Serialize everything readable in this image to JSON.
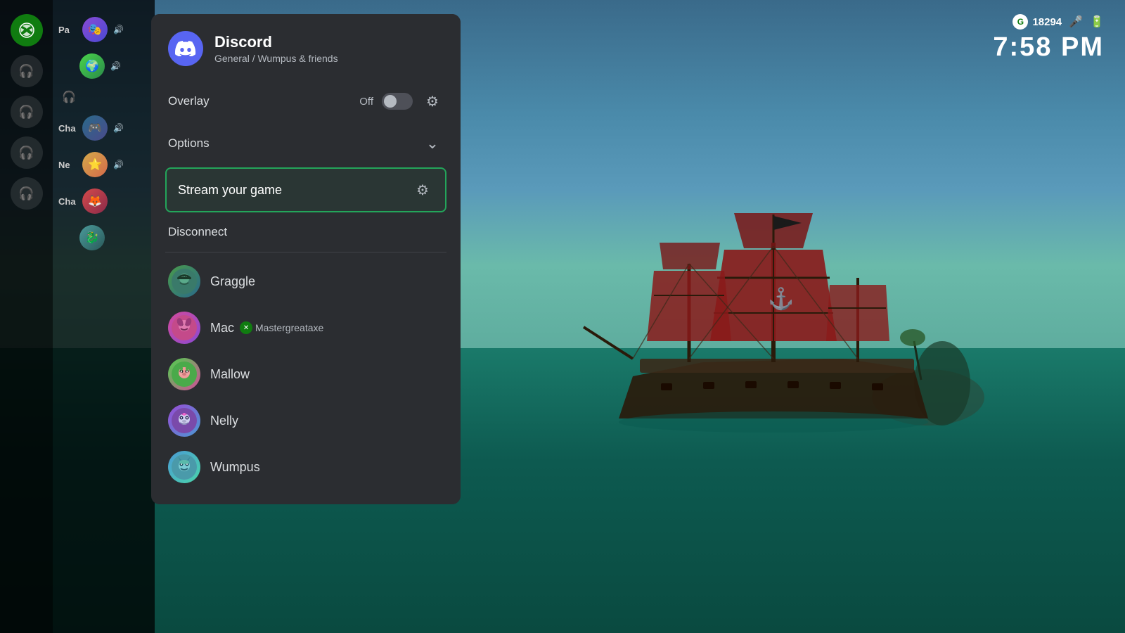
{
  "background": {
    "description": "Sea of Thieves pirate ship game background"
  },
  "hud": {
    "score": "18294",
    "time": "7:58 PM",
    "g_label": "G",
    "mic_symbol": "🎤",
    "battery_symbol": "🔋"
  },
  "discord": {
    "app_name": "Discord",
    "channel": "General / Wumpus & friends",
    "logo_symbol": "⊕",
    "sections": {
      "overlay": {
        "label": "Overlay",
        "status": "Off",
        "toggle_state": "off"
      },
      "options": {
        "label": "Options"
      },
      "stream": {
        "label": "Stream your game"
      },
      "disconnect": {
        "label": "Disconnect"
      }
    },
    "users": [
      {
        "name": "Graggle",
        "avatar_class": "av-graggle",
        "avatar_emoji": "🐧"
      },
      {
        "name": "Mac",
        "avatar_class": "av-mac",
        "avatar_emoji": "🌸",
        "xbox_gamertag": "Mastergreataxe",
        "has_xbox": true
      },
      {
        "name": "Mallow",
        "avatar_class": "av-mallow",
        "avatar_emoji": "🐷"
      },
      {
        "name": "Nelly",
        "avatar_class": "av-nelly",
        "avatar_emoji": "🐱"
      },
      {
        "name": "Wumpus",
        "avatar_class": "av-wumpus",
        "avatar_emoji": "🦎"
      }
    ]
  },
  "sidebar": {
    "labels": [
      "Pa",
      "Ch",
      "Ne",
      "Ch"
    ],
    "icon_types": [
      "headset",
      "headset",
      "headset",
      "headset"
    ]
  }
}
